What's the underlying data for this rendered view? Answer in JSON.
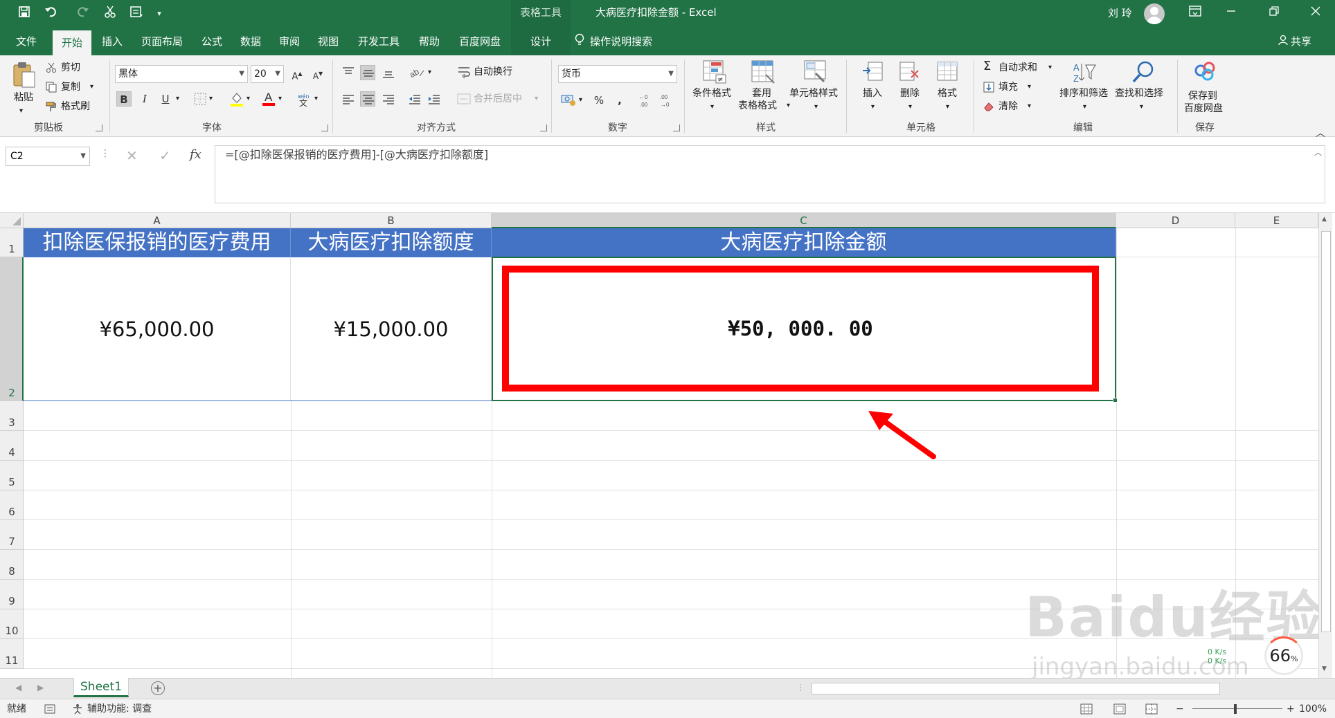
{
  "window": {
    "title": "大病医疗扣除金额 - Excel",
    "contextual_tools": "表格工具",
    "user": "刘 玲",
    "quick_access": [
      "save-icon",
      "undo-icon",
      "redo-icon",
      "cut-icon",
      "form-icon",
      "customize-icon"
    ]
  },
  "tabs": [
    {
      "label": "文件"
    },
    {
      "label": "开始",
      "active": true
    },
    {
      "label": "插入"
    },
    {
      "label": "页面布局"
    },
    {
      "label": "公式"
    },
    {
      "label": "数据"
    },
    {
      "label": "审阅"
    },
    {
      "label": "视图"
    },
    {
      "label": "开发工具"
    },
    {
      "label": "帮助"
    },
    {
      "label": "百度网盘"
    },
    {
      "label": "设计"
    }
  ],
  "tell_me": "操作说明搜索",
  "share": "共享",
  "ribbon": {
    "clipboard": {
      "label": "剪贴板",
      "paste": "粘贴",
      "cut": "剪切",
      "copy": "复制",
      "format_painter": "格式刷"
    },
    "font": {
      "label": "字体",
      "name": "黑体",
      "size": "20"
    },
    "alignment": {
      "label": "对齐方式",
      "wrap": "自动换行",
      "merge": "合并后居中"
    },
    "number": {
      "label": "数字",
      "format": "货币"
    },
    "styles": {
      "label": "样式",
      "conditional": "条件格式",
      "table_line1": "套用",
      "table_line2": "表格格式",
      "cell_styles": "单元格样式"
    },
    "cells": {
      "label": "单元格",
      "insert": "插入",
      "delete": "删除",
      "format": "格式"
    },
    "editing": {
      "label": "编辑",
      "autosum": "自动求和",
      "fill": "填充",
      "clear": "清除",
      "sort": "排序和筛选",
      "find": "查找和选择"
    },
    "save": {
      "label": "保存",
      "line1": "保存到",
      "line2": "百度网盘"
    }
  },
  "formula_bar": {
    "name_box": "C2",
    "formula": "=[@扣除医保报销的医疗费用]-[@大病医疗扣除额度]"
  },
  "sheet": {
    "columns": [
      "A",
      "B",
      "C",
      "D",
      "E"
    ],
    "rows": [
      "1",
      "2",
      "3",
      "4",
      "5",
      "6",
      "7",
      "8",
      "9",
      "10",
      "11"
    ],
    "headers": [
      "扣除医保报销的医疗费用",
      "大病医疗扣除额度",
      "大病医疗扣除金额"
    ],
    "values": [
      "¥65,000.00",
      "¥15,000.00",
      "¥50, 000. 00"
    ],
    "selected_cell": "C2"
  },
  "watermark": {
    "logo": "Baidu经验",
    "url": "jingyan.baidu.com"
  },
  "speed_badge": {
    "percent": "66",
    "up": "0 K/s",
    "down": "0 K/s"
  },
  "sheet_tabs": [
    {
      "label": "Sheet1",
      "active": true
    }
  ],
  "status": {
    "ready": "就绪",
    "accessibility": "辅助功能: 调查",
    "zoom": "100%"
  },
  "colors": {
    "accent": "#217346",
    "table_header": "#4472c4",
    "highlight": "#ff0000"
  }
}
